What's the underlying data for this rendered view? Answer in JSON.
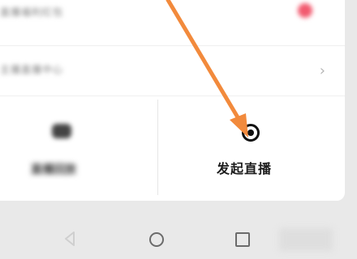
{
  "settings": {
    "row1_label": "直播福利红包",
    "row2_label": "主播直播中心"
  },
  "actions": {
    "left_label": "直播回放",
    "right_label": "发起直播"
  },
  "colors": {
    "accent_arrow": "#f28a3c",
    "red_dot": "#f25a6f"
  },
  "icons": {
    "chevron": "chevron-right-icon",
    "record": "record-icon",
    "back": "back-icon",
    "home": "home-icon",
    "recent": "recent-apps-icon"
  }
}
